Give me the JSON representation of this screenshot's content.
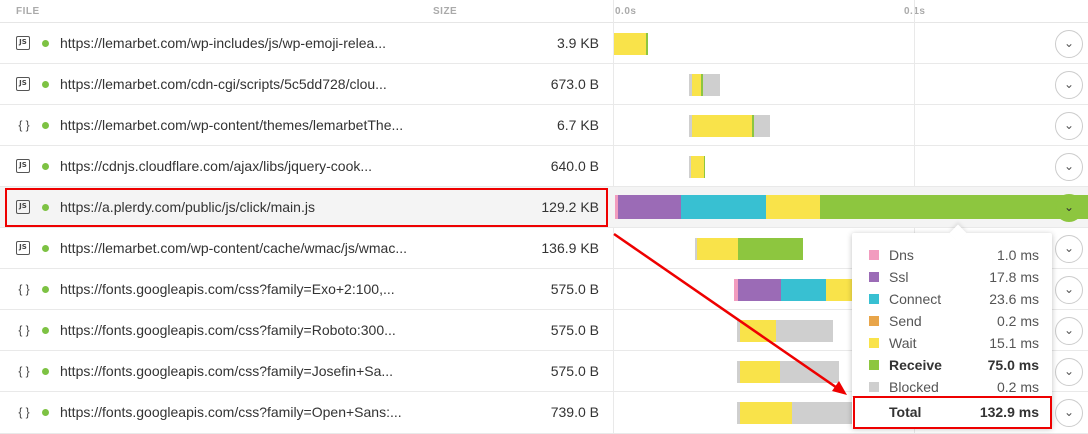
{
  "header": {
    "file_label": "FILE",
    "size_label": "SIZE",
    "t0_label": "0.0s",
    "t1_label": "0.1s"
  },
  "colors": {
    "dns": "#f29cbf",
    "ssl": "#9b6bb6",
    "connect": "#38c0d2",
    "send": "#e8a54a",
    "wait": "#f9e34a",
    "receive": "#8dc63f",
    "blocked": "#cfcfcf",
    "dot": "#7dc243",
    "highlight": "#ee0000"
  },
  "rows": [
    {
      "type": "js",
      "url": "https://lemarbet.com/wp-includes/js/wp-emoji-relea...",
      "size": "3.9 KB",
      "icon": "js-file-icon"
    },
    {
      "type": "js",
      "url": "https://lemarbet.com/cdn-cgi/scripts/5c5dd728/clou...",
      "size": "673.0 B",
      "icon": "js-file-icon"
    },
    {
      "type": "css",
      "url": "https://lemarbet.com/wp-content/themes/lemarbetThe...",
      "size": "6.7 KB",
      "icon": "braces-icon"
    },
    {
      "type": "js",
      "url": "https://cdnjs.cloudflare.com/ajax/libs/jquery-cook...",
      "size": "640.0 B",
      "icon": "js-file-icon"
    },
    {
      "type": "js",
      "url": "https://a.plerdy.com/public/js/click/main.js",
      "size": "129.2 KB",
      "icon": "js-file-icon"
    },
    {
      "type": "js",
      "url": "https://lemarbet.com/wp-content/cache/wmac/js/wmac...",
      "size": "136.9 KB",
      "icon": "js-file-icon"
    },
    {
      "type": "css",
      "url": "https://fonts.googleapis.com/css?family=Exo+2:100,...",
      "size": "575.0 B",
      "icon": "braces-icon"
    },
    {
      "type": "css",
      "url": "https://fonts.googleapis.com/css?family=Roboto:300...",
      "size": "575.0 B",
      "icon": "braces-icon"
    },
    {
      "type": "css",
      "url": "https://fonts.googleapis.com/css?family=Josefin+Sa...",
      "size": "575.0 B",
      "icon": "braces-icon"
    },
    {
      "type": "css",
      "url": "https://fonts.googleapis.com/css?family=Open+Sans:...",
      "size": "739.0 B",
      "icon": "braces-icon"
    }
  ],
  "tooltip": {
    "items": [
      {
        "label": "Dns",
        "value": "1.0 ms"
      },
      {
        "label": "Ssl",
        "value": "17.8 ms"
      },
      {
        "label": "Connect",
        "value": "23.6 ms"
      },
      {
        "label": "Send",
        "value": "0.2 ms"
      },
      {
        "label": "Wait",
        "value": "15.1 ms"
      },
      {
        "label": "Receive",
        "value": "75.0 ms"
      },
      {
        "label": "Blocked",
        "value": "0.2 ms"
      }
    ],
    "total_label": "Total",
    "total_value": "132.9 ms"
  }
}
